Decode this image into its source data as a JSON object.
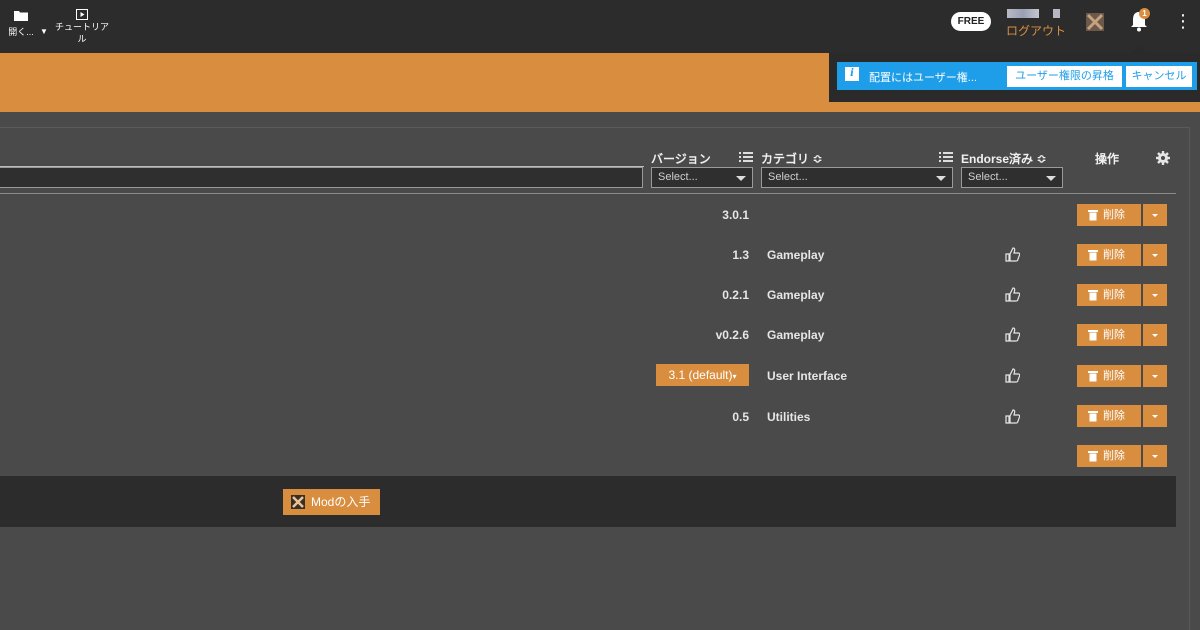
{
  "topbar": {
    "badge": "FREE",
    "logout": "ログアウト",
    "notification_count": "1"
  },
  "toolbar": {
    "open_label": "開く...",
    "tutorial_label": "チュートリアル"
  },
  "notification": {
    "message": "配置にはユーザー権...",
    "elevate_button": "ユーザー権限の昇格",
    "cancel_button": "キャンセル"
  },
  "columns": {
    "version": "バージョン",
    "category": "カテゴリ ≎",
    "endorsed": "Endorse済み ≎",
    "actions": "操作"
  },
  "filters": {
    "version_placeholder": "Select...",
    "category_placeholder": "Select...",
    "endorsed_placeholder": "Select..."
  },
  "rows": [
    {
      "version": "3.0.1",
      "category": "",
      "endorsed": false
    },
    {
      "version": "1.3",
      "category": "Gameplay",
      "endorsed": true
    },
    {
      "version": "0.2.1",
      "category": "Gameplay",
      "endorsed": true
    },
    {
      "version": "v0.2.6",
      "category": "Gameplay",
      "endorsed": true
    },
    {
      "version": "3.1 (default)",
      "category": "User Interface",
      "endorsed": true
    },
    {
      "version": "0.5",
      "category": "Utilities",
      "endorsed": true
    },
    {
      "version": "",
      "category": "",
      "endorsed": false
    }
  ],
  "row_action": "削除",
  "footer": {
    "get_mods": "Modの入手"
  },
  "colors": {
    "accent": "#d98e3f",
    "topbar": "#2c2c2c",
    "panel": "#4a4a4a",
    "notification": "#1e9ee8"
  }
}
